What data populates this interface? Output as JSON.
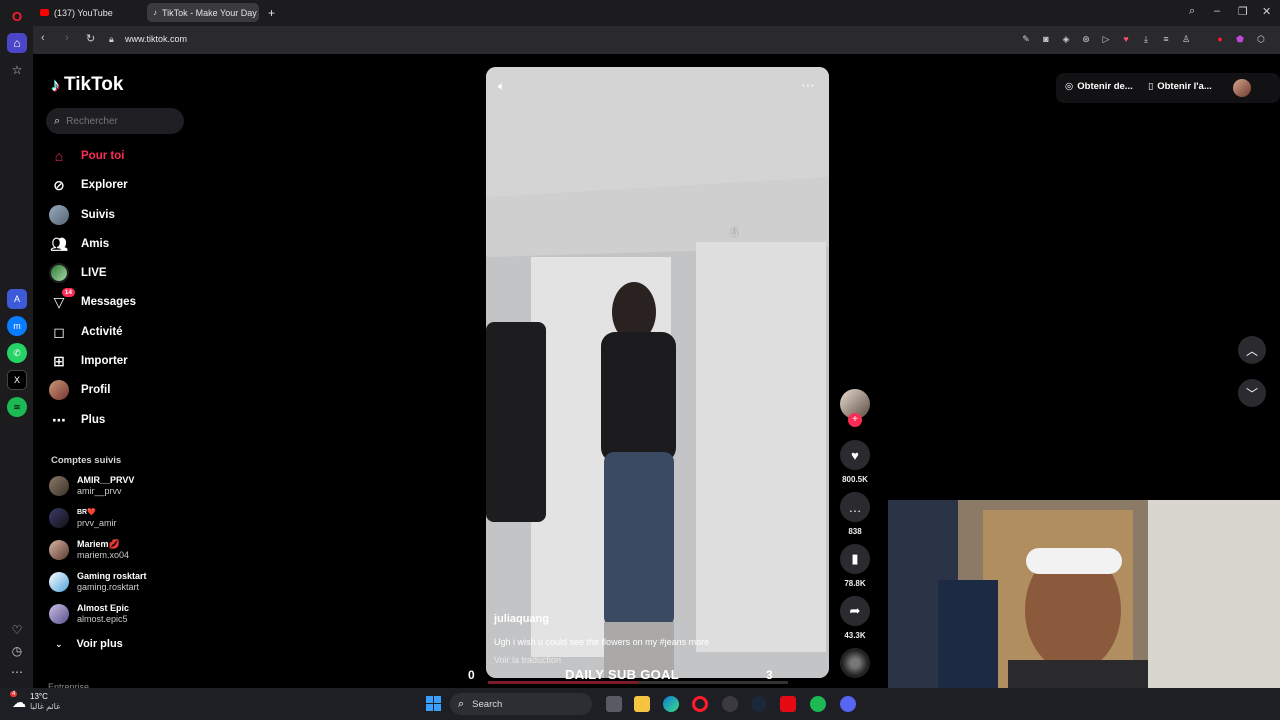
{
  "browser": {
    "tabs": [
      {
        "label": "(137) YouTube",
        "icon": "youtube-icon"
      },
      {
        "label": "TikTok - Make Your Day",
        "icon": "tiktok-icon"
      }
    ],
    "url": "www.tiktok.com"
  },
  "sidebar": {
    "logo": "TikTok",
    "search_placeholder": "Rechercher",
    "nav": [
      {
        "label": "Pour toi",
        "icon": "home-icon"
      },
      {
        "label": "Explorer",
        "icon": "compass-icon"
      },
      {
        "label": "Suivis",
        "icon": "following-avatar-icon"
      },
      {
        "label": "Amis",
        "icon": "friends-icon"
      },
      {
        "label": "LIVE",
        "icon": "live-icon"
      },
      {
        "label": "Messages",
        "icon": "messages-icon",
        "badge": "14"
      },
      {
        "label": "Activité",
        "icon": "activity-icon"
      },
      {
        "label": "Importer",
        "icon": "upload-icon"
      },
      {
        "label": "Profil",
        "icon": "profile-avatar-icon"
      },
      {
        "label": "Plus",
        "icon": "more-icon"
      }
    ],
    "followed_title": "Comptes suivis",
    "accounts": [
      {
        "name": "AMIR__PRVV",
        "user": "amir__prvv"
      },
      {
        "name": "BR❤️",
        "user": "prvv_amir"
      },
      {
        "name": "Mariem💋",
        "user": "mariem.xo04"
      },
      {
        "name": "Gaming rosktart",
        "user": "gaming.rosktart"
      },
      {
        "name": "Almost Epic",
        "user": "almost.epic5"
      }
    ],
    "see_more": "Voir plus",
    "enterprise": "Entreprise"
  },
  "video": {
    "author": "juliaquang",
    "caption": "Ugh i wish u could see the flowers on my #jeans more",
    "translate": "Voir la traduction"
  },
  "actions": {
    "likes": "800.5K",
    "comments": "838",
    "saves": "78.8K",
    "shares": "43.3K"
  },
  "topbar": {
    "get_coins": "Obtenir de...",
    "get_app": "Obtenir l'a..."
  },
  "overlay": {
    "goal_start": "0",
    "goal_label": "DAILY SUB GOAL",
    "goal_end": "3"
  },
  "taskbar": {
    "weather_temp": "13°C",
    "weather_badge": "4",
    "weather_desc": "غائم غالبا",
    "search": "Search"
  },
  "colors": {
    "tiktok_red": "#fe2c55",
    "opera_red": "#ff1b2d"
  }
}
